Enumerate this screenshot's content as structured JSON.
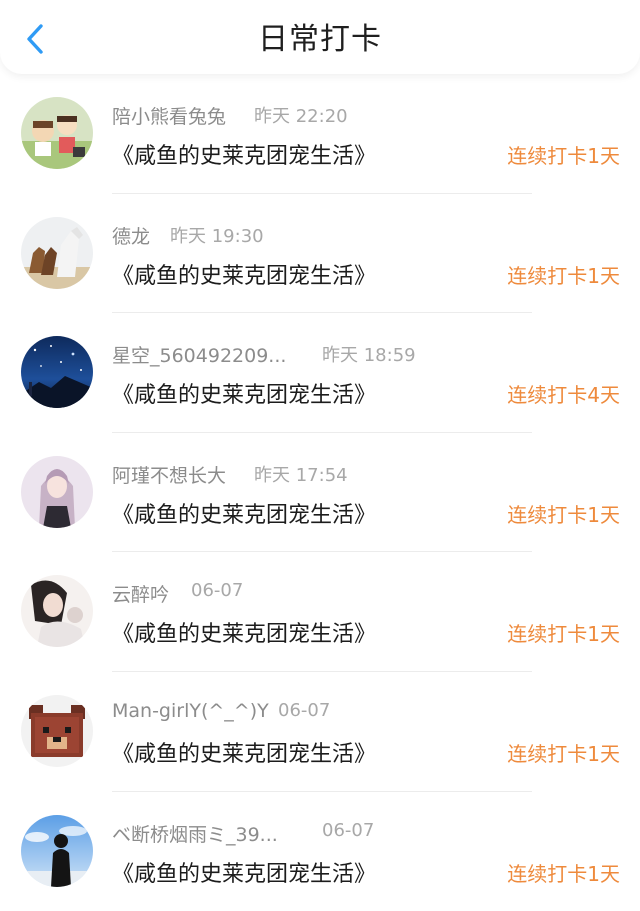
{
  "header": {
    "title": "日常打卡",
    "back_icon": "chevron-left-icon"
  },
  "colors": {
    "accent": "#2f9bf5",
    "streak": "#ee8a3c",
    "username": "#8c8c8c",
    "time": "#a8a8a8"
  },
  "rows": [
    {
      "username": "陪小熊看兔兔",
      "time": "昨天 22:20",
      "book": "《咸鱼的史莱克团宠生活》",
      "streak": "连续打卡1天",
      "avatar": "avatar-cartoon-icon"
    },
    {
      "username": "德龙",
      "time": "昨天 19:30",
      "book": "《咸鱼的史莱克团宠生活》",
      "streak": "连续打卡1天",
      "avatar": "avatar-horses-icon"
    },
    {
      "username": "星空_560492209...",
      "time": "昨天 18:59",
      "book": "《咸鱼的史莱克团宠生活》",
      "streak": "连续打卡4天",
      "avatar": "avatar-starry-sky-icon"
    },
    {
      "username": "阿瑾不想长大",
      "time": "昨天 17:54",
      "book": "《咸鱼的史莱克团宠生活》",
      "streak": "连续打卡1天",
      "avatar": "avatar-anime-girl-icon"
    },
    {
      "username": "云醉吟",
      "time": "06-07",
      "book": "《咸鱼的史莱克团宠生活》",
      "streak": "连续打卡1天",
      "avatar": "avatar-girl-portrait-icon"
    },
    {
      "username": "Man-girlY(^_^)Y",
      "time": "06-07",
      "book": "《咸鱼的史莱克团宠生活》",
      "streak": "连续打卡1天",
      "avatar": "avatar-pixel-bear-icon"
    },
    {
      "username": "ベ断桥烟雨ミ_39...",
      "time": "06-07",
      "book": "《咸鱼的史莱克团宠生活》",
      "streak": "连续打卡1天",
      "avatar": "avatar-silhouette-icon"
    }
  ]
}
